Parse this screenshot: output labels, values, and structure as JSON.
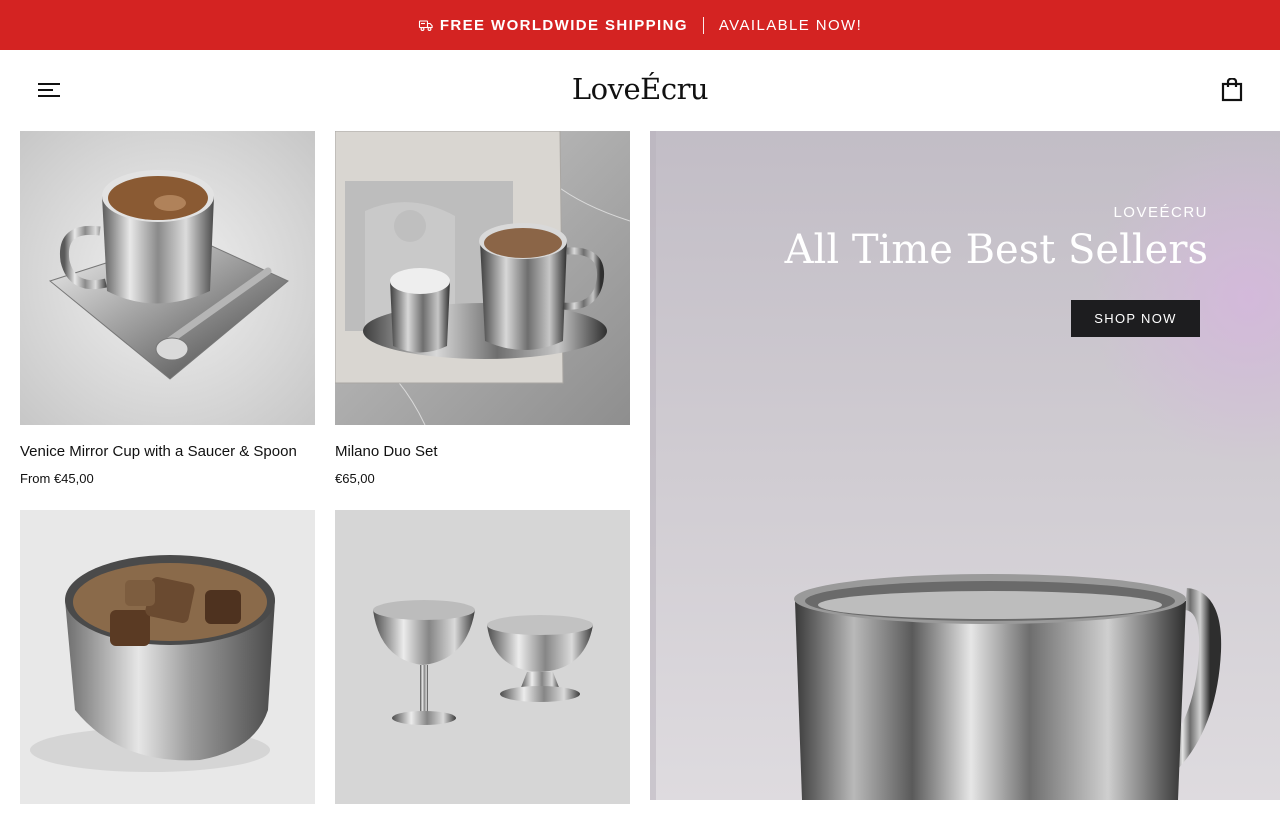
{
  "announcement": {
    "bold_text": "FREE WORLDWIDE SHIPPING",
    "text": "AVAILABLE NOW!",
    "icon": "truck-icon"
  },
  "header": {
    "logo": "LoveÉcru",
    "menu_icon": "menu-icon",
    "cart_icon": "shopping-bag-icon"
  },
  "products": [
    {
      "title": "Venice Mirror Cup with a Saucer & Spoon",
      "price": "From €45,00",
      "image": "mirror cup with saucer and spoon"
    },
    {
      "title": "Milano Duo Set",
      "price": "€65,00",
      "image": "two mirror cups on tray"
    },
    {
      "title": "",
      "price": "",
      "image": "steel cup with iced coffee"
    },
    {
      "title": "",
      "price": "",
      "image": "two steel dessert cups"
    }
  ],
  "hero": {
    "eyebrow": "LOVEÉCRU",
    "headline": "All Time Best Sellers",
    "button": "SHOP NOW"
  },
  "colors": {
    "announcement_bg": "#d42322",
    "button_bg": "#1d1d1f",
    "hero_bg": "#cbc7cf"
  }
}
